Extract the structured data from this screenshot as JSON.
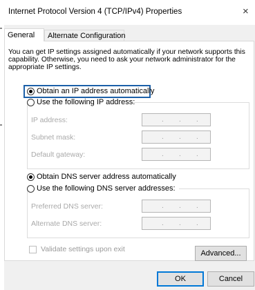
{
  "window": {
    "title": "Internet Protocol Version 4 (TCP/IPv4) Properties",
    "close_glyph": "×"
  },
  "tabs": [
    {
      "label": "General",
      "selected": true
    },
    {
      "label": "Alternate Configuration",
      "selected": false
    }
  ],
  "general": {
    "info_text": "You can get IP settings assigned automatically if your network supports this capability. Otherwise, you need to ask your network administrator for the appropriate IP settings.",
    "ip_auto_label": "Obtain an IP address automatically",
    "ip_manual_label": "Use the following IP address:",
    "ip_fields": [
      {
        "label": "IP address:",
        "value": ". . ."
      },
      {
        "label": "Subnet mask:",
        "value": ". . ."
      },
      {
        "label": "Default gateway:",
        "value": ". . ."
      }
    ],
    "dns_auto_label": "Obtain DNS server address automatically",
    "dns_manual_label": "Use the following DNS server addresses:",
    "dns_fields": [
      {
        "label": "Preferred DNS server:",
        "value": ". . ."
      },
      {
        "label": "Alternate DNS server:",
        "value": ". . ."
      }
    ],
    "validate_label": "Validate settings upon exit",
    "validate_checked": false,
    "advanced_label": "Advanced..."
  },
  "buttons": {
    "ok_label": "OK",
    "cancel_label": "Cancel"
  },
  "colors": {
    "focus_outline": "#1b5fa8",
    "ok_border": "#0078d7"
  }
}
